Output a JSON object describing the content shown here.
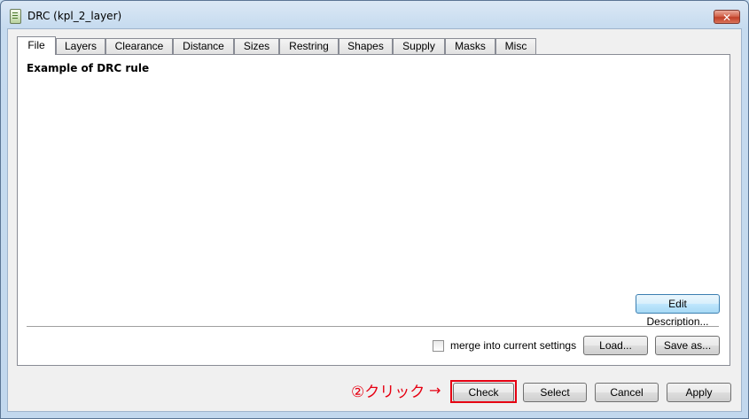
{
  "window": {
    "title": "DRC (kpl_2_layer)",
    "close_glyph": "✕"
  },
  "tabs": [
    {
      "label": "File",
      "active": true
    },
    {
      "label": "Layers"
    },
    {
      "label": "Clearance"
    },
    {
      "label": "Distance"
    },
    {
      "label": "Sizes"
    },
    {
      "label": "Restring"
    },
    {
      "label": "Shapes"
    },
    {
      "label": "Supply"
    },
    {
      "label": "Masks"
    },
    {
      "label": "Misc"
    }
  ],
  "file_panel": {
    "description": "Example of DRC rule",
    "edit_description_label": "Edit Description...",
    "merge_label": "merge into current settings",
    "merge_checked": false,
    "load_label": "Load...",
    "save_as_label": "Save as..."
  },
  "footer": {
    "check_label": "Check",
    "select_label": "Select",
    "cancel_label": "Cancel",
    "apply_label": "Apply"
  },
  "annotation": {
    "text": "②クリック",
    "arrow": "→",
    "color": "#e60012"
  },
  "icons": {
    "app": "eagle-app-icon",
    "close": "close-icon"
  }
}
